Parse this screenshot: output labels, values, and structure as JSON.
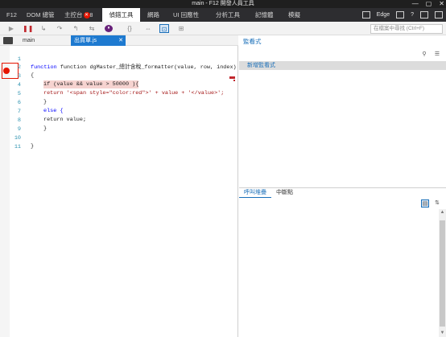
{
  "window": {
    "title": "main - F12 開發人員工具",
    "min_label": "—",
    "max_label": "▢",
    "close_label": "✕"
  },
  "tabs": {
    "f12": "F12",
    "dom": "DOM 總管",
    "console": "主控台",
    "console_errors": "8",
    "debugger": "偵錯工具",
    "network": "網路",
    "ui": "UI 回應性",
    "profiler": "分析工具",
    "memory": "記憶體",
    "emulation": "模擬",
    "browser": "Edge",
    "help": "?"
  },
  "toolbar": {
    "play": "▶",
    "pause": "❚❚",
    "search_placeholder": "在檔案中尋找 (Ctrl+F)"
  },
  "doc_tabs": {
    "main": "main",
    "active_file": "出貨單.js",
    "close": "✕"
  },
  "code": {
    "lines": [
      {
        "n": "1",
        "text": "function dgMaster_總計含稅_formatter(value, row, index)"
      },
      {
        "n": "2",
        "text": "{"
      },
      {
        "n": "3",
        "text": "if (value && value > 50000 ){"
      },
      {
        "n": "4",
        "pre": "return '<span style=\"color:red\">' + value + '</value>';"
      },
      {
        "n": "5",
        "text": "}"
      },
      {
        "n": "6",
        "text": "else {"
      },
      {
        "n": "7",
        "text": "return value;"
      },
      {
        "n": "8",
        "text": "}"
      },
      {
        "n": "9",
        "text": ""
      },
      {
        "n": "10",
        "text": "}"
      },
      {
        "n": "11",
        "text": ""
      }
    ]
  },
  "watch": {
    "title": "監看式",
    "add": "新增監看式"
  },
  "callstack": {
    "tab1": "呼叫堆疊",
    "tab2": "中斷點",
    "up": "▲",
    "down": "▼"
  }
}
